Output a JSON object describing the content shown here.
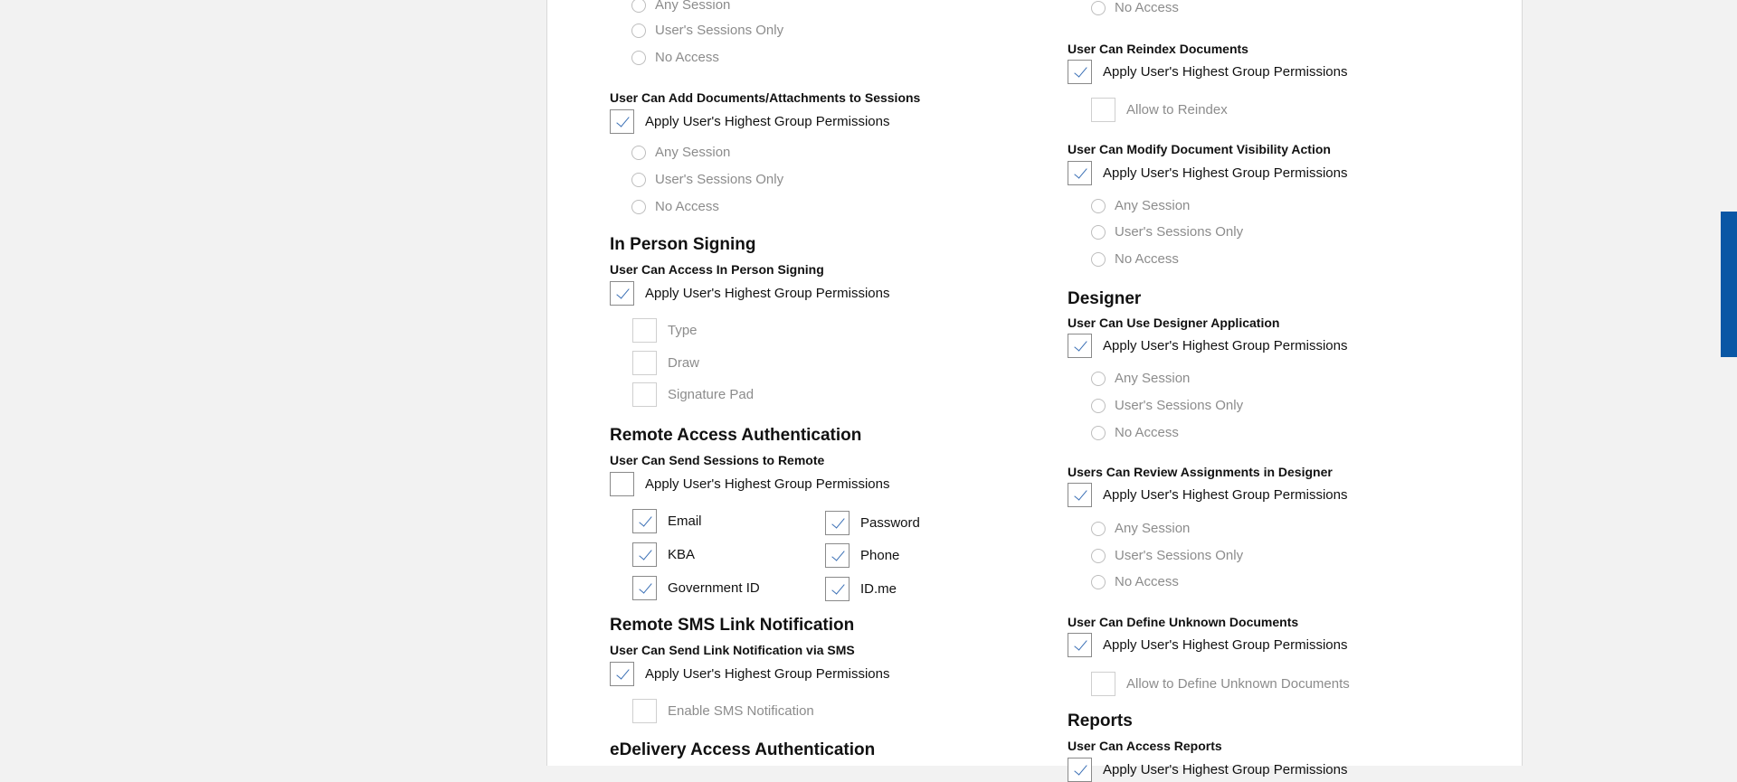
{
  "common": {
    "apply_label": "Apply User's Highest Group Permissions",
    "any_session": "Any Session",
    "users_sessions_only": "User's Sessions Only",
    "no_access": "No Access"
  },
  "left": {
    "add_documents": {
      "title": "User Can Add Documents/Attachments to Sessions"
    },
    "in_person": {
      "section": "In Person Signing",
      "title": "User Can Access In Person Signing",
      "options": [
        "Type",
        "Draw",
        "Signature Pad"
      ]
    },
    "remote": {
      "section": "Remote Access Authentication",
      "title": "User Can Send Sessions to Remote",
      "methods_left": [
        "Email",
        "KBA",
        "Government ID"
      ],
      "methods_right": [
        "Password",
        "Phone",
        "ID.me"
      ]
    },
    "sms": {
      "section": "Remote SMS Link Notification",
      "title": "User Can Send Link Notification via SMS",
      "option": "Enable SMS Notification"
    },
    "edelivery": {
      "section": "eDelivery Access Authentication"
    }
  },
  "right": {
    "reindex": {
      "title": "User Can Reindex Documents",
      "option": "Allow to Reindex"
    },
    "visibility": {
      "title": "User Can Modify Document Visibility Action"
    },
    "designer": {
      "section": "Designer",
      "title": "User Can Use Designer Application"
    },
    "review": {
      "title": "Users Can Review Assignments in Designer"
    },
    "unknown": {
      "title": "User Can Define Unknown Documents",
      "option": "Allow to Define Unknown Documents"
    },
    "reports": {
      "section": "Reports",
      "title": "User Can Access Reports"
    }
  }
}
